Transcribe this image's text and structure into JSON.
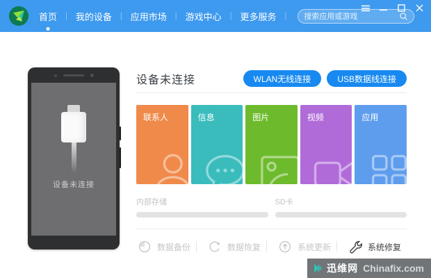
{
  "colors": {
    "topbar_blue": "#3E9AEE",
    "button_blue": "#1789F0",
    "watermark_teal": "#2EC4B6",
    "tile_contacts": "#F08A4B",
    "tile_messages": "#3ABCBD",
    "tile_pictures": "#6DBB2D",
    "tile_videos": "#B06BD9",
    "tile_apps": "#5E9DED"
  },
  "topbar": {
    "nav": [
      {
        "label": "首页",
        "active": true
      },
      {
        "label": "我的设备",
        "active": false
      },
      {
        "label": "应用市场",
        "active": false
      },
      {
        "label": "游戏中心",
        "active": false
      },
      {
        "label": "更多服务",
        "active": false
      }
    ],
    "search": {
      "placeholder": "搜索应用或游戏"
    },
    "window_controls": [
      {
        "name": "menu"
      },
      {
        "name": "minimize"
      },
      {
        "name": "maximize"
      },
      {
        "name": "close"
      }
    ]
  },
  "phone": {
    "status": "设备未连接"
  },
  "panel": {
    "title": "设备未连接",
    "connect_buttons": [
      {
        "label": "WLAN无线连接"
      },
      {
        "label": "USB数据线连接"
      }
    ],
    "tiles": [
      {
        "label": "联系人",
        "color": "#F08A4B",
        "icon": "contact-icon"
      },
      {
        "label": "信息",
        "color": "#3ABCBD",
        "icon": "message-icon"
      },
      {
        "label": "图片",
        "color": "#6DBB2D",
        "icon": "picture-icon"
      },
      {
        "label": "视频",
        "color": "#B06BD9",
        "icon": "video-icon"
      },
      {
        "label": "应用",
        "color": "#5E9DED",
        "icon": "apps-icon"
      }
    ],
    "storage": [
      {
        "label": "内部存储"
      },
      {
        "label": "SD卡"
      }
    ],
    "actions": [
      {
        "label": "数据备份",
        "enabled": false,
        "icon": "backup-icon"
      },
      {
        "label": "数据恢复",
        "enabled": false,
        "icon": "restore-icon"
      },
      {
        "label": "系统更新",
        "enabled": false,
        "icon": "update-icon"
      },
      {
        "label": "系统修复",
        "enabled": true,
        "icon": "repair-icon"
      }
    ]
  },
  "watermark": {
    "site_cn": "迅维网",
    "site_en": "Chinafix.com"
  }
}
